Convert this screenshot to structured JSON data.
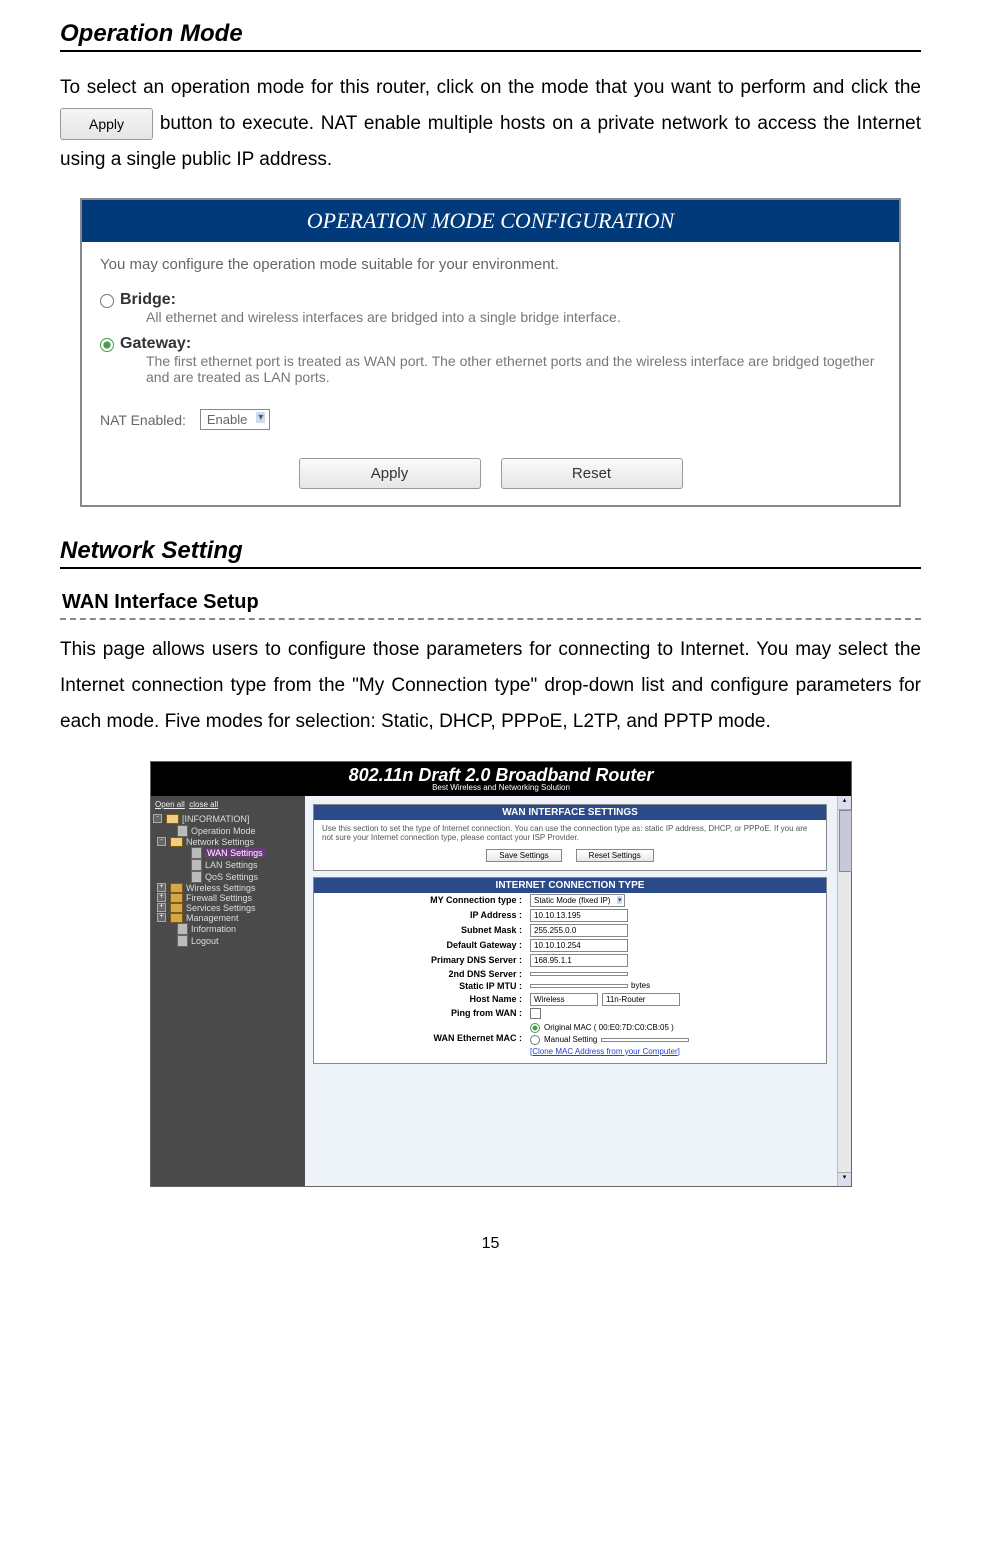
{
  "sections": {
    "op_mode_title": "Operation Mode",
    "op_mode_text1": "To select an operation mode for this router, click on the mode that you want to perform and click the ",
    "apply_inline": "Apply",
    "op_mode_text2": " button to execute. NAT enable multiple hosts on a private network to access the Internet using a single public IP address.",
    "net_setting_title": "Network Setting",
    "wan_title": "WAN Interface Setup",
    "wan_text": "This page allows users to configure those parameters for connecting to Internet. You may select the Internet connection type from the \"My Connection type\" drop-down list and configure parameters for each mode. Five modes for selection: Static, DHCP, PPPoE, L2TP, and PPTP mode."
  },
  "config_box": {
    "header": "OPERATION MODE CONFIGURATION",
    "desc": "You may configure the operation mode suitable for your environment.",
    "bridge_label": "Bridge:",
    "bridge_desc": "All ethernet and wireless interfaces are bridged into a single bridge interface.",
    "gateway_label": "Gateway:",
    "gateway_desc": "The first ethernet port is treated as WAN port. The other ethernet ports and the wireless interface are bridged together and are treated as LAN ports.",
    "nat_label": "NAT Enabled:",
    "nat_value": "Enable",
    "apply_btn": "Apply",
    "reset_btn": "Reset"
  },
  "router": {
    "brand": "802.11n Draft 2.0  Broadband Router",
    "subtitle": "Best Wireless and Networking Solution",
    "nav_open": "Open all",
    "nav_close": "close all",
    "nav_info": "[INFORMATION]",
    "nav_op": "Operation Mode",
    "nav_net": "Network Settings",
    "nav_wan": "WAN Settings",
    "nav_lan": "LAN Settings",
    "nav_qos": "QoS Settings",
    "nav_wireless": "Wireless Settings",
    "nav_firewall": "Firewall Settings",
    "nav_services": "Services Settings",
    "nav_mgmt": "Management",
    "nav_infoitem": "Information",
    "nav_logout": "Logout",
    "wan_panel_head": "WAN INTERFACE SETTINGS",
    "wan_panel_desc": "Use this section to set the type of Internet connection. You can use the connection type as: static IP address, DHCP, or PPPoE. If you are not sure your Internet connection type, please contact your ISP Provider.",
    "save_btn": "Save Settings",
    "reset_btn2": "Reset Settings",
    "ict_head": "INTERNET CONNECTION TYPE",
    "labels": {
      "conn": "MY Connection type :",
      "ip": "IP Address :",
      "mask": "Subnet Mask :",
      "gw": "Default Gateway :",
      "dns1": "Primary DNS Server :",
      "dns2": "2nd DNS Server :",
      "mtu": "Static IP MTU :",
      "host": "Host Name :",
      "ping": "Ping from WAN :",
      "mac": "WAN Ethernet MAC :"
    },
    "values": {
      "conn": "Static Mode (fixed IP)",
      "ip": "10.10.13.195",
      "mask": "255.255.0.0",
      "gw": "10.10.10.254",
      "dns1": "168.95.1.1",
      "dns2": "",
      "mtu": "",
      "mtu_unit": "bytes",
      "host1": "Wireless",
      "host2": "11n-Router",
      "mac_orig": "Original MAC ( 00:E0:7D:C0:CB:05 )",
      "mac_manual": "Manual Setting",
      "mac_clone": "[Clone MAC Address from your Computer]"
    }
  },
  "page_num": "15"
}
